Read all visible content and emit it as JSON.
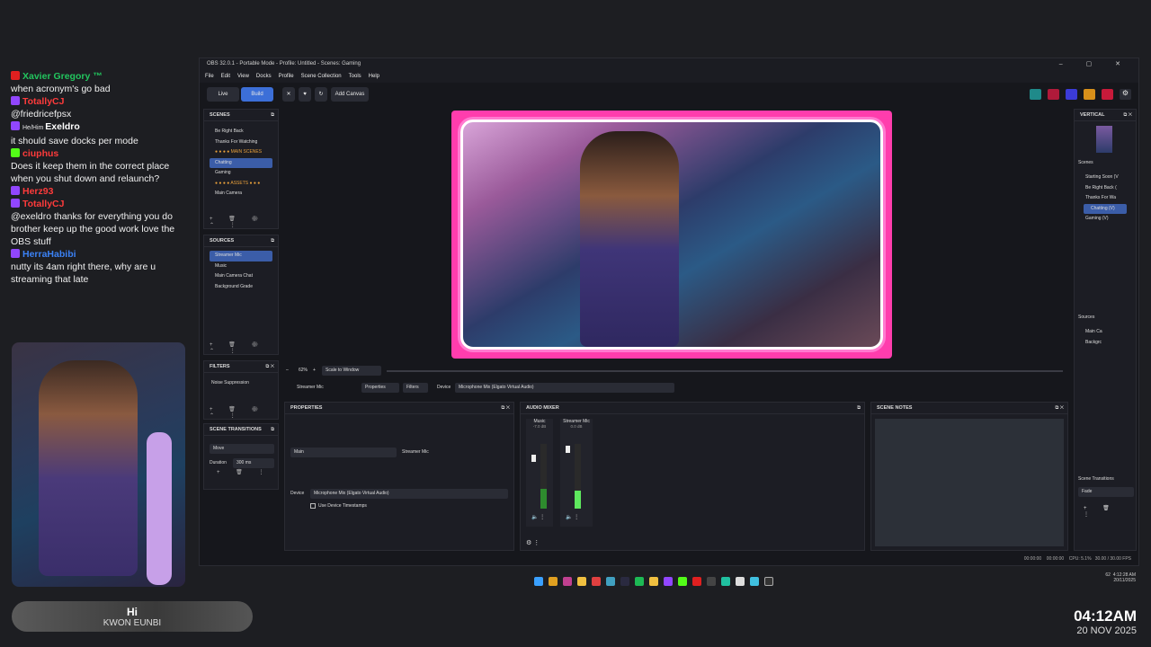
{
  "chat": [
    {
      "platform": "yt",
      "name": "Xavier Gregory",
      "suffix": "™",
      "color": "#22c55e",
      "text": "when acronym's go bad"
    },
    {
      "platform": "tw",
      "name": "TotallyCJ",
      "color": "#ff3b3b",
      "text": "@friedricefpsx"
    },
    {
      "platform": "tw",
      "badge": "He/Him",
      "name": "Exeldro",
      "color": "#ffffff",
      "text": "it should save docks per mode"
    },
    {
      "platform": "kk",
      "name": "ciuphus",
      "color": "#ff3b3b",
      "text": "Does it keep them in the correct place when you shut down and relaunch?"
    },
    {
      "platform": "tw",
      "name": "Herz93",
      "color": "#ff3b3b",
      "text": ""
    },
    {
      "platform": "tw",
      "name": "TotallyCJ",
      "color": "#ff3b3b",
      "text": "@exeldro thanks for everything you do brother keep up the good work love the OBS stuff"
    },
    {
      "platform": "tw",
      "name": "HerraHabibi",
      "color": "#3b82f6",
      "text": "nutty its 4am right there, why are u streaming that late"
    }
  ],
  "namepill": {
    "line1": "Hi",
    "line2": "KWON EUNBI"
  },
  "clock": {
    "time": "04:12AM",
    "date": "20 NOV 2025"
  },
  "obs": {
    "title": "OBS 32.0.1 - Portable Mode - Profile: Untitled - Scenes: Gaming",
    "window_controls": "– ▢ ✕",
    "menu": [
      "File",
      "Edit",
      "View",
      "Docks",
      "Profile",
      "Scene Collection",
      "Tools",
      "Help"
    ],
    "mode_live": "Live",
    "mode_build": "Build",
    "add_canvas": "Add Canvas",
    "scenes_title": "SCENES",
    "scenes": [
      {
        "label": "Be Right Back",
        "type": "item"
      },
      {
        "label": "Thanks For Watching",
        "type": "item"
      },
      {
        "label": "● ● ● ● MAIN SCENES",
        "type": "hdr"
      },
      {
        "label": "Chatting",
        "type": "sel"
      },
      {
        "label": "Gaming",
        "type": "item"
      },
      {
        "label": "● ● ● ● ASSETS ● ● ●",
        "type": "hdr"
      },
      {
        "label": "Main Camera",
        "type": "item"
      }
    ],
    "sources_title": "SOURCES",
    "sources": [
      "Streamer Mic",
      "Music",
      "Main Camera Chat",
      "Background Grade"
    ],
    "filters_title": "FILTERS",
    "filters": [
      "Noise Suppression"
    ],
    "transitions_title": "SCENE TRANSITIONS",
    "transition_value": "Move",
    "duration_label": "Duration",
    "duration_value": "300 ms",
    "zoom": "62%",
    "scale_mode": "Scale to Window",
    "ctx_source": "Streamer Mic",
    "ctx_properties": "Properties",
    "ctx_filters": "Filters",
    "ctx_device_label": "Device",
    "ctx_device_value": "Microphone Mix (Elgato Virtual Audio)",
    "properties_title": "PROPERTIES",
    "prop_main": "Main",
    "prop_source": "Streamer Mic",
    "prop_device_label": "Device",
    "prop_device_value": "Microphone Mix (Elgato Virtual Audio)",
    "prop_timestamps": "Use Device Timestamps",
    "mixer_title": "AUDIO MIXER",
    "mixer": [
      {
        "name": "Music",
        "db": "-7.0 dB"
      },
      {
        "name": "Streamer Mic",
        "db": "0.0 dB"
      }
    ],
    "notes_title": "SCENE NOTES",
    "vertical_title": "VERTICAL",
    "v_scenes_label": "Scenes",
    "v_scenes": [
      "Starting Soon (V",
      "Be Right Back (",
      "Thanks For Wa",
      "Chatting (V)",
      "Gaming (V)"
    ],
    "v_sources_label": "Sources",
    "v_sources": [
      "Main Ca",
      "Backgrc"
    ],
    "v_transitions_label": "Scene Transitions",
    "v_transition_value": "Fade",
    "status": {
      "t1": "00:00:00",
      "t2": "00:00:00",
      "cpu": "CPU: 5.1%",
      "fps": "30.00 / 30.00 FPS"
    }
  },
  "tray": {
    "time": "4:12:28 AM",
    "date": "20/11/2025",
    "num": "62"
  },
  "colors": {
    "build": "#3c6fd8",
    "preview_border": "#ff3dad",
    "selection": "#3b5da8"
  }
}
